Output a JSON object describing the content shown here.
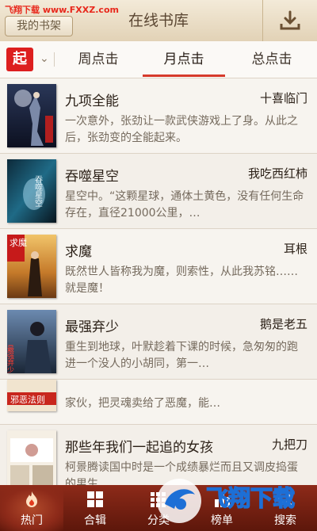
{
  "watermark_top": "飞翔下载 www.FXXZ.com",
  "header": {
    "my_shelf": "我的书架",
    "title": "在线书库",
    "download_icon": "download-icon"
  },
  "tabs": {
    "badge": "起",
    "items": [
      {
        "label": "周点击",
        "active": false
      },
      {
        "label": "月点击",
        "active": true
      },
      {
        "label": "总点击",
        "active": false
      }
    ]
  },
  "books": [
    {
      "title": "九项全能",
      "author": "十喜临门",
      "desc": "一次意外，张劲让一款武侠游戏上了身。从此之后，张劲变的全能起来。"
    },
    {
      "title": "吞噬星空",
      "author": "我吃西红柿",
      "desc": "星空中。“这颗星球，通体土黄色，没有任何生命存在，直径21000公里，…"
    },
    {
      "title": "求魔",
      "author": "耳根",
      "desc": "既然世人皆称我为魔，则索性，从此我苏铭……就是魔！"
    },
    {
      "title": "最强弃少",
      "author": "鹅是老五",
      "desc": "重生到地球，叶默趁着下课的时候，急匆匆的跑进一个没人的小胡同，第一…"
    },
    {
      "title": "",
      "author": "",
      "desc": "家伙，把灵魂卖给了恶魔，能…"
    },
    {
      "title": "那些年我们一起追的女孩",
      "author": "九把刀",
      "desc": "柯景腾读国中时是一个成绩暴烂而且又调皮捣蛋的男生…"
    }
  ],
  "covers": [
    "",
    "吞噬星空",
    "求魔",
    "最强弃少",
    "邪恶法则",
    ""
  ],
  "nav": [
    {
      "label": "热门",
      "active": true
    },
    {
      "label": "合辑",
      "active": false
    },
    {
      "label": "分类",
      "active": false
    },
    {
      "label": "榜单",
      "active": false
    },
    {
      "label": "搜索",
      "active": false
    }
  ],
  "watermark_bottom": "飞翔下载",
  "colors": {
    "accent": "#d63a2b",
    "nav_bg": "#7a2212",
    "header_bg": "#e9ddc7"
  }
}
